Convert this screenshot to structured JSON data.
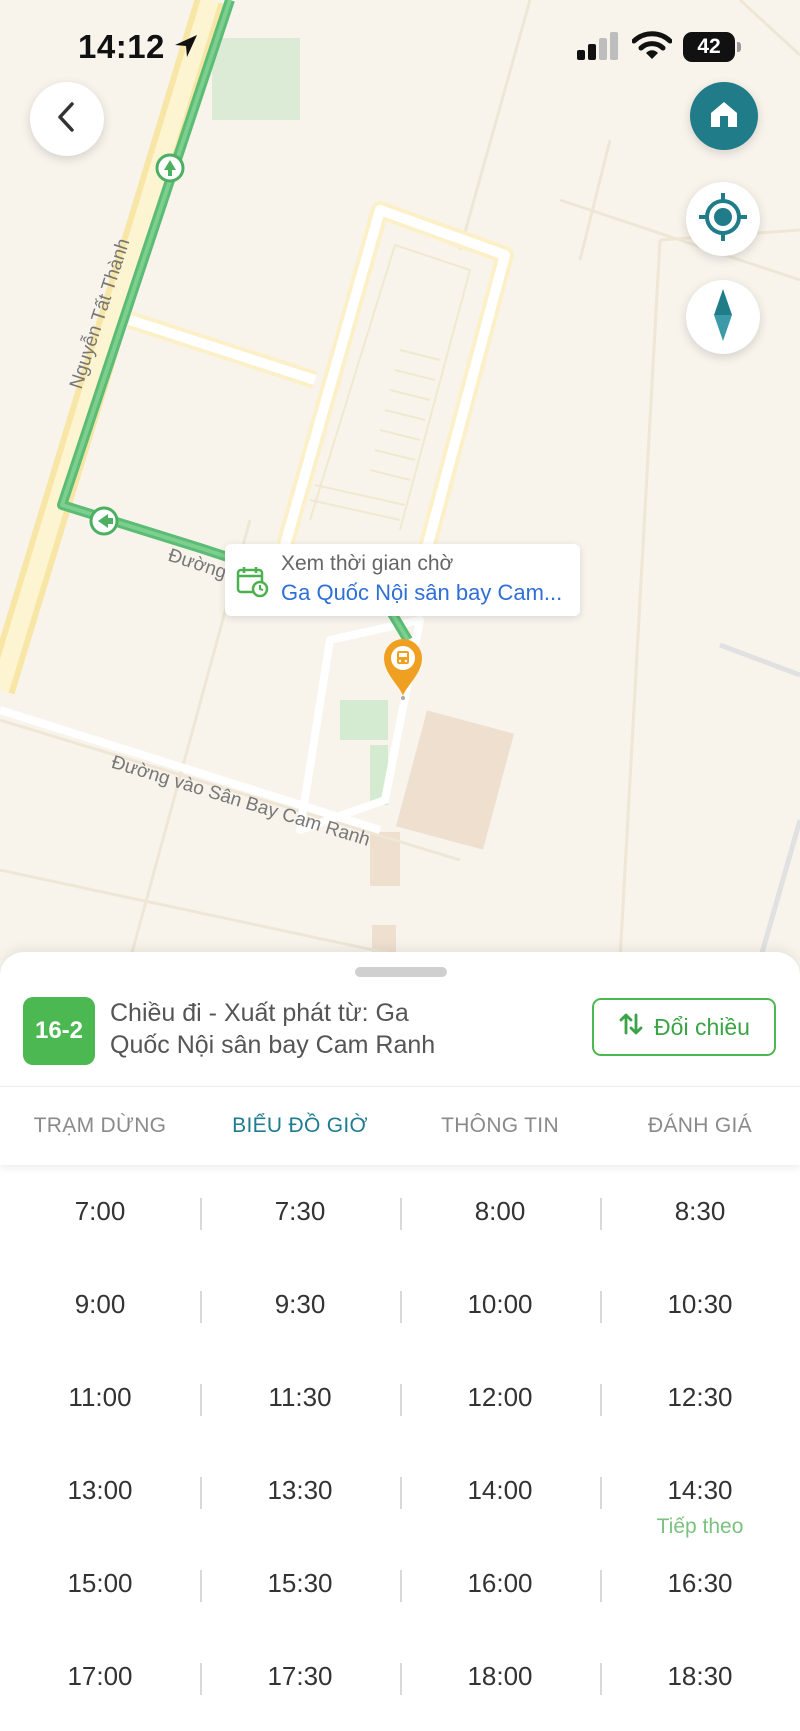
{
  "status_bar": {
    "time": "14:12",
    "battery": "42"
  },
  "map": {
    "street_labels": [
      "Nguyễn Tất Thành",
      "Đường",
      "Đường vào Sân Bay Cam Ranh"
    ],
    "stop_tooltip": {
      "line1": "Xem thời gian chờ",
      "line2": "Ga Quốc Nội sân bay Cam..."
    },
    "icons": [
      "back-icon",
      "home-icon",
      "locate-icon",
      "compass-icon",
      "bus-stop-pin-icon",
      "calendar-clock-icon"
    ]
  },
  "route": {
    "number": "16-2",
    "direction_line1": "Chiều đi - Xuất phát từ: Ga",
    "direction_line2": "Quốc Nội sân bay Cam Ranh",
    "swap_label": "Đổi chiều"
  },
  "tabs": [
    {
      "label": "TRẠM DỪNG",
      "active": false
    },
    {
      "label": "BIỂU ĐỒ GIỜ",
      "active": true
    },
    {
      "label": "THÔNG TIN",
      "active": false
    },
    {
      "label": "ĐÁNH GIÁ",
      "active": false
    }
  ],
  "schedule": {
    "rows": [
      [
        "7:00",
        "7:30",
        "8:00",
        "8:30"
      ],
      [
        "9:00",
        "9:30",
        "10:00",
        "10:30"
      ],
      [
        "11:00",
        "11:30",
        "12:00",
        "12:30"
      ],
      [
        "13:00",
        "13:30",
        "14:00",
        "14:30"
      ],
      [
        "15:00",
        "15:30",
        "16:00",
        "16:30"
      ],
      [
        "17:00",
        "17:30",
        "18:00",
        "18:30"
      ]
    ],
    "next_label": "Tiếp theo"
  },
  "colors": {
    "accent_green": "#4cb852",
    "tab_active": "#1f7c8f",
    "home_button": "#1f7c88",
    "pin": "#f0a020",
    "link_blue": "#2f6fd6"
  }
}
